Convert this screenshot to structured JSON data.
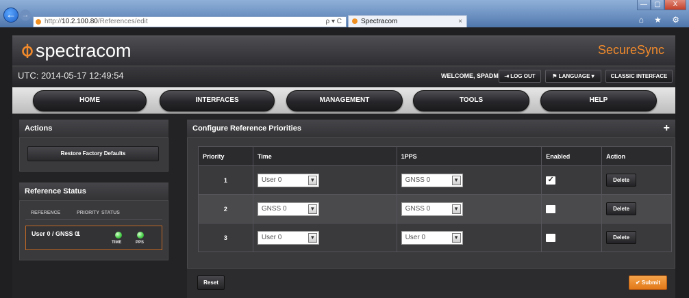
{
  "browser": {
    "address_scheme": "http://",
    "address_host": "10.2.100.80",
    "address_path": "/References/edit",
    "address_tools": "ρ ▾ C",
    "tab_title": "Spectracom",
    "tab_close": "×",
    "nav_back": "←",
    "nav_forward": "→",
    "window_min": "—",
    "window_max": "▢",
    "window_close": "X",
    "toolbar_icons": "⌂ ★ ⚙"
  },
  "header": {
    "brand": "spectracom",
    "product": "SecureSync"
  },
  "statusbar": {
    "utc": "UTC: 2014-05-17 12:49:54",
    "welcome": "WELCOME, SPADMIN",
    "logout": "⇥ LOG OUT",
    "language": "⚑ LANGUAGE ▾",
    "classic": "CLASSIC INTERFACE"
  },
  "nav": {
    "home": "HOME",
    "interfaces": "INTERFACES",
    "management": "MANAGEMENT",
    "tools": "TOOLS",
    "help": "HELP"
  },
  "actions": {
    "title": "Actions",
    "restore": "Restore Factory Defaults"
  },
  "reference_status": {
    "title": "Reference Status",
    "col_reference": "REFERENCE",
    "col_priority": "PRIORITY",
    "col_status": "STATUS",
    "row": {
      "reference": "User 0 / GNSS 0",
      "priority": "1",
      "time_label": "TIME",
      "pps_label": "PPS"
    },
    "led_color": "#4bd04b"
  },
  "priorities": {
    "title": "Configure Reference Priorities",
    "add": "+",
    "headers": {
      "priority": "Priority",
      "time": "Time",
      "pps": "1PPS",
      "enabled": "Enabled",
      "action": "Action"
    },
    "rows": [
      {
        "priority": "1",
        "time": "User 0",
        "pps": "GNSS 0",
        "enabled": true,
        "action": "Delete"
      },
      {
        "priority": "2",
        "time": "GNSS 0",
        "pps": "GNSS 0",
        "enabled": false,
        "action": "Delete"
      },
      {
        "priority": "3",
        "time": "User 0",
        "pps": "User 0",
        "enabled": false,
        "action": "Delete"
      }
    ],
    "check_mark": "✓",
    "caret": "▼",
    "reset": "Reset",
    "submit": "✔ Submit"
  },
  "colors": {
    "accent": "#f0892c",
    "submit": "#e8861f"
  }
}
